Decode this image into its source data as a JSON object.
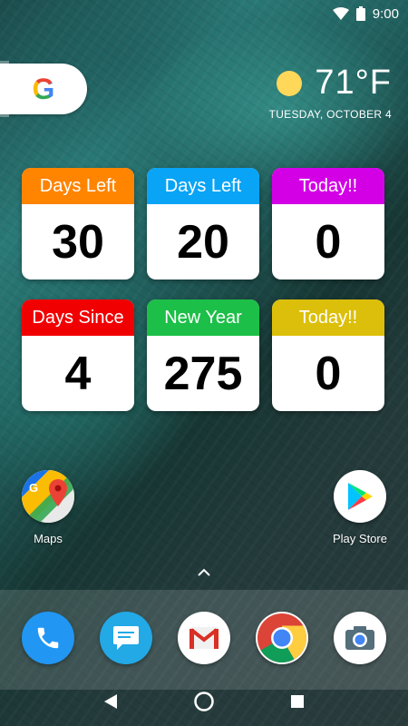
{
  "status_bar": {
    "time": "9:00"
  },
  "weather": {
    "temperature": "71°F",
    "date": "TUESDAY, OCTOBER 4"
  },
  "widgets": [
    {
      "title": "Days Left",
      "value": "30",
      "color": "#ff8400"
    },
    {
      "title": "Days Left",
      "value": "20",
      "color": "#09a4f6"
    },
    {
      "title": "Today!!",
      "value": "0",
      "color": "#d300e6"
    },
    {
      "title": "Days Since",
      "value": "4",
      "color": "#f00000"
    },
    {
      "title": "New Year",
      "value": "275",
      "color": "#1cbf47"
    },
    {
      "title": "Today!!",
      "value": "0",
      "color": "#dcbf0a"
    }
  ],
  "apps": [
    {
      "label": "Maps",
      "icon": "maps-icon"
    },
    {
      "label": "Play Store",
      "icon": "play-store-icon"
    }
  ],
  "dock": [
    {
      "icon": "phone-icon"
    },
    {
      "icon": "messages-icon"
    },
    {
      "icon": "gmail-icon"
    },
    {
      "icon": "chrome-icon"
    },
    {
      "icon": "camera-icon"
    }
  ],
  "navigation": {
    "buttons": [
      "back-icon",
      "home-icon",
      "recents-icon"
    ]
  }
}
